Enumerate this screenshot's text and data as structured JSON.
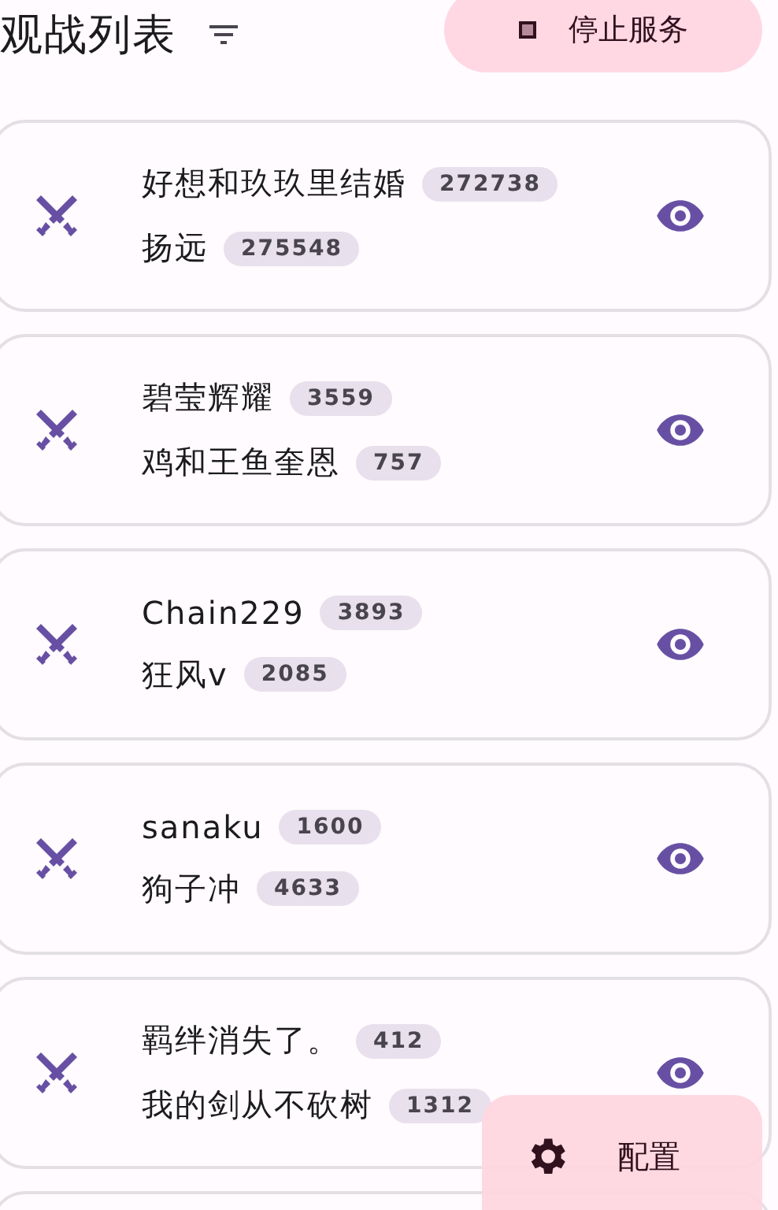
{
  "header": {
    "title": "观战列表",
    "stop_button": "停止服务"
  },
  "matches": [
    {
      "player_1": {
        "name": "好想和玖玖里结婚",
        "score": "272738"
      },
      "player_2": {
        "name": "扬远",
        "score": "275548"
      }
    },
    {
      "player_1": {
        "name": "碧莹辉耀",
        "score": "3559"
      },
      "player_2": {
        "name": "鸡和王鱼奎恩",
        "score": "757"
      }
    },
    {
      "player_1": {
        "name": "Chain229",
        "score": "3893"
      },
      "player_2": {
        "name": "狂风v",
        "score": "2085"
      }
    },
    {
      "player_1": {
        "name": "sanaku",
        "score": "1600"
      },
      "player_2": {
        "name": "狗子冲",
        "score": "4633"
      }
    },
    {
      "player_1": {
        "name": "羁绊消失了。",
        "score": "412"
      },
      "player_2": {
        "name": "我的剑从不砍树",
        "score": "1312"
      }
    }
  ],
  "fab": {
    "label": "配置"
  }
}
